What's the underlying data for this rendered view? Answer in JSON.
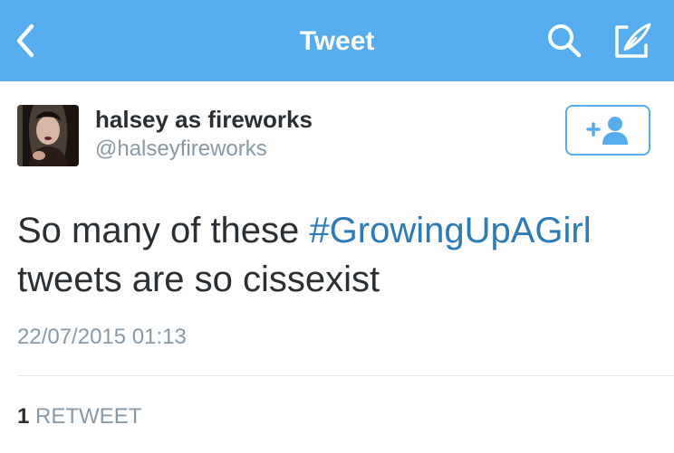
{
  "colors": {
    "navbar_bg": "#55acee",
    "navbar_text": "#ffffff",
    "text_primary": "#292f33",
    "text_secondary": "#8899a6",
    "link": "#2b7bb9",
    "divider": "#e1e8ed"
  },
  "navbar": {
    "back_icon": "chevron-left-icon",
    "title": "Tweet",
    "search_icon": "search-icon",
    "compose_icon": "compose-icon"
  },
  "tweet": {
    "author": {
      "display_name": "halsey as fireworks",
      "handle": "@halseyfireworks",
      "avatar": "avatar-photo"
    },
    "follow_button_icon": "follow-user-icon",
    "text_before": "So many of these ",
    "hashtag": "#GrowingUpAGirl",
    "text_after": " tweets are so cissexist",
    "timestamp": "22/07/2015 01:13",
    "retweets": {
      "count": "1",
      "label": "RETWEET"
    }
  }
}
